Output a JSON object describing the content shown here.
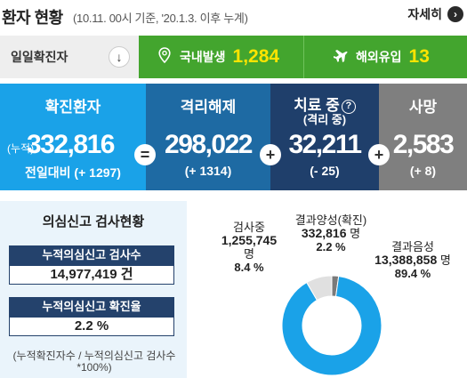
{
  "header": {
    "title": "환자 현황",
    "subtitle": "(10.11. 00시 기준, '20.1.3. 이후 누계)",
    "detail_label": "자세히",
    "detail_icon": "chevron-right-icon"
  },
  "daily": {
    "label": "일일확진자",
    "arrow_icon": "arrow-down-icon",
    "domestic_label": "국내발생",
    "domestic_value": "1,284",
    "domestic_icon": "location-pin-icon",
    "overseas_label": "해외유입",
    "overseas_value": "13",
    "overseas_icon": "airplane-icon"
  },
  "stats": {
    "confirmed": {
      "title": "확진환자",
      "prefix": "(누적)",
      "value": "332,816",
      "delta": "전일대비 (+ 1297)"
    },
    "released": {
      "title": "격리해제",
      "value": "298,022",
      "delta": "(+ 1314)"
    },
    "treatment": {
      "title": "치료 중",
      "subtitle": "(격리 중)",
      "help_icon": "question-icon",
      "value": "32,211",
      "delta": "(- 25)"
    },
    "death": {
      "title": "사망",
      "value": "2,583",
      "delta": "(+ 8)"
    },
    "ops": {
      "equals": "=",
      "plus": "+"
    }
  },
  "tests": {
    "title": "의심신고 검사현황",
    "cumulative_label": "누적의심신고 검사수",
    "cumulative_value": "14,977,419 건",
    "rate_label": "누적의심신고 확진율",
    "rate_value": "2.2 %",
    "note": "(누적확진자수 / 누적의심신고 검사수 *100%)"
  },
  "donut": {
    "testing": {
      "label": "검사중",
      "value": "1,255,745",
      "unit": "명",
      "percent": "8.4 %",
      "share": 8.4,
      "color": "#e0e0e0"
    },
    "positive": {
      "label": "결과양성(확진)",
      "value": "332,816",
      "unit": "명",
      "percent": "2.2 %",
      "share": 2.2,
      "color": "#7a7a7a"
    },
    "negative": {
      "label": "결과음성",
      "value": "13,388,858",
      "unit": "명",
      "percent": "89.4 %",
      "share": 89.4,
      "color": "#1aa2e8"
    }
  },
  "colors": {
    "green": "#43a52e",
    "blue_light": "#1aa2e8",
    "blue_mid": "#1e6aa3",
    "blue_dark": "#1f3f6b",
    "gray": "#7f7f7f",
    "yellow": "#ffe400",
    "navy": "#24426c"
  }
}
